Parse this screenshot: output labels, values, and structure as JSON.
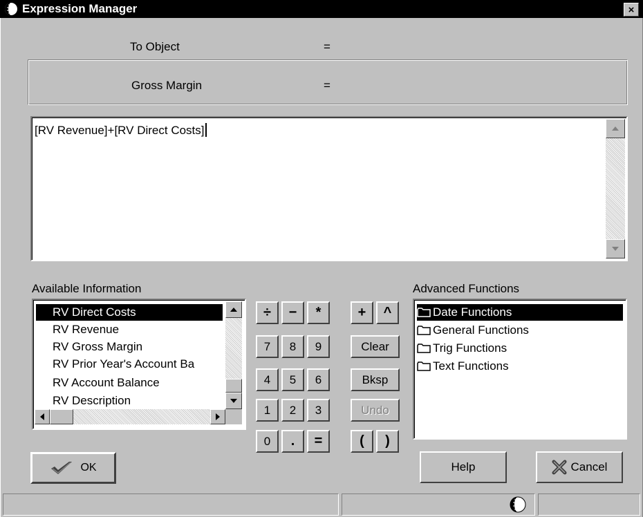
{
  "window": {
    "title": "Expression Manager",
    "close_glyph": "×"
  },
  "header": {
    "label1": "To Object",
    "eq1": "=",
    "label2": "Gross Margin",
    "eq2": "="
  },
  "expression": {
    "text": "[RV Revenue]+[RV Direct Costs]"
  },
  "available": {
    "label": "Available Information",
    "items": [
      "RV Direct Costs",
      "RV Revenue",
      "RV Gross Margin",
      "RV Prior Year's Account Ba",
      "RV Account Balance",
      "RV Description"
    ],
    "selected_index": 0
  },
  "keypad": {
    "row1": [
      "÷",
      "−",
      "*",
      "+",
      "^"
    ],
    "row2": [
      "7",
      "8",
      "9"
    ],
    "clear": "Clear",
    "row3": [
      "4",
      "5",
      "6"
    ],
    "bksp": "Bksp",
    "row4": [
      "1",
      "2",
      "3"
    ],
    "undo": "Undo",
    "row5": [
      "0",
      ".",
      "=",
      "(",
      ")"
    ]
  },
  "advanced": {
    "label": "Advanced Functions",
    "items": [
      "Date Functions",
      "General Functions",
      "Trig Functions",
      "Text Functions"
    ],
    "selected_index": 0
  },
  "buttons": {
    "ok": "OK",
    "help": "Help",
    "cancel": "Cancel"
  },
  "icons": {
    "title": "globe-icon",
    "ok": "checkmark-icon",
    "cancel": "x-icon",
    "status": "globe-icon",
    "folder": "folder-icon"
  },
  "colors": {
    "selection": "#000000",
    "face": "#c0c0c0",
    "titlebar": "#000000"
  }
}
